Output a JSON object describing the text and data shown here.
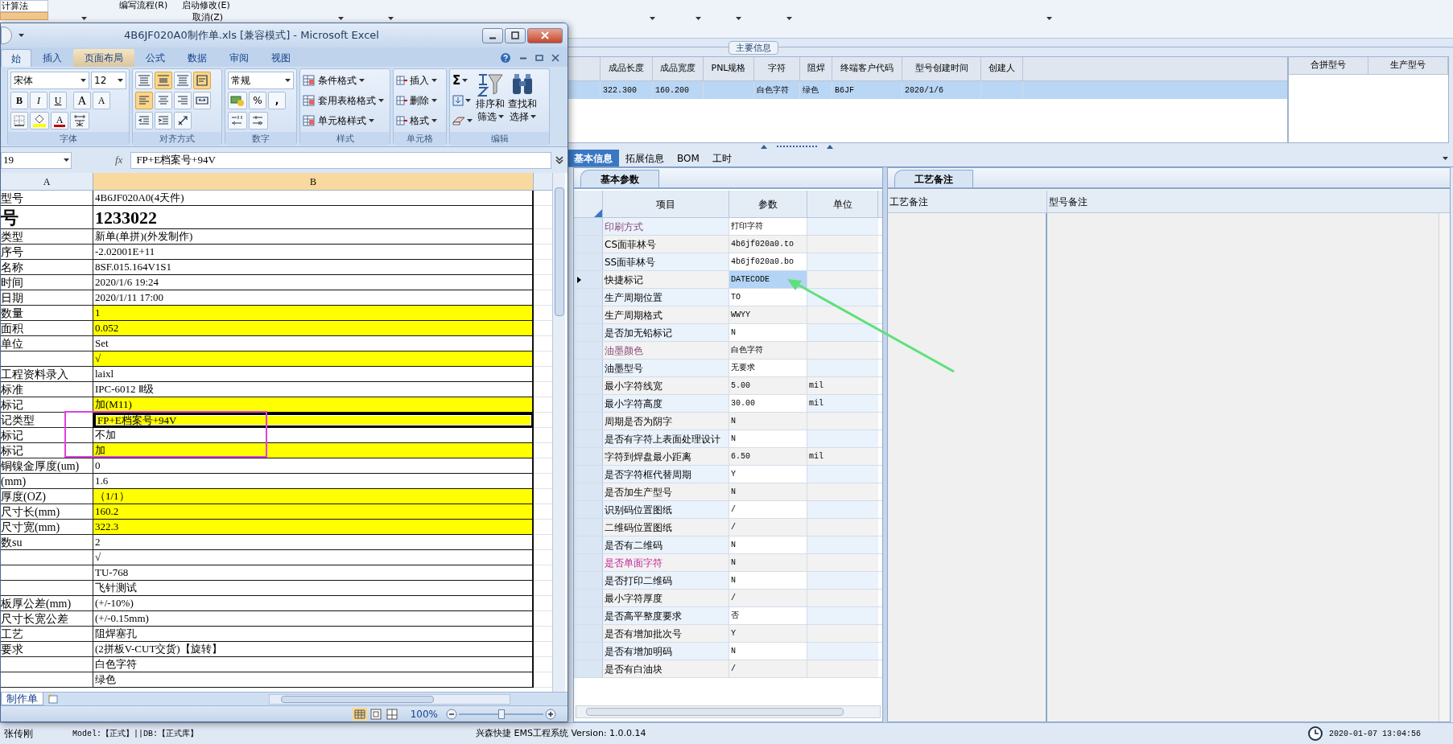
{
  "background": {
    "nav_item": "计算法",
    "toolbar": {
      "row_1": [
        "编写流程(R)",
        "启动修改(E)"
      ],
      "row_2": "取消(Z)"
    },
    "main_info": {
      "title": "主要信息",
      "columns": [
        "成品长度",
        "成品宽度",
        "PNL规格",
        "字符",
        "阻焊",
        "终端客户代码",
        "型号创建时间",
        "创建人"
      ],
      "rows": [
        {
          "selected": true,
          "cells": [
            "322.300",
            "160.200",
            null,
            "白色字符",
            "绿色",
            "B6JF",
            "2020/1/6",
            null
          ]
        }
      ]
    },
    "merge_grid": {
      "columns": [
        "合拼型号",
        "生产型号"
      ]
    },
    "tabs": [
      {
        "label": "基本信息",
        "selected": true
      },
      {
        "label": "拓展信息",
        "selected": false
      },
      {
        "label": "BOM",
        "selected": false
      },
      {
        "label": "工时",
        "selected": false
      }
    ],
    "params": {
      "tab": "基本参数",
      "columns": [
        "项目",
        "参数",
        "单位"
      ],
      "rows": [
        {
          "item": "印刷方式",
          "value": "打印字符",
          "kind": "muted",
          "selected": false
        },
        {
          "item": "CS面菲林号",
          "value": "4b6jf020a0.to",
          "kind": "plain",
          "selected": false
        },
        {
          "item": "SS面菲林号",
          "value": "4b6jf020a0.bo",
          "kind": "plain",
          "selected": false
        },
        {
          "item": "快捷标记",
          "value": "DATECODE",
          "kind": "plain",
          "selected": true
        },
        {
          "item": "生产周期位置",
          "value": "TO",
          "kind": "plain",
          "selected": false
        },
        {
          "item": "生产周期格式",
          "value": "WWYY",
          "kind": "plain",
          "selected": false
        },
        {
          "item": "是否加无铅标记",
          "value": "N",
          "kind": "plain",
          "selected": false
        },
        {
          "item": "油墨颜色",
          "value": "白色字符",
          "kind": "muted",
          "selected": false
        },
        {
          "item": "油墨型号",
          "value": "无要求",
          "kind": "plain",
          "selected": false
        },
        {
          "item": "最小字符线宽",
          "value": "5.00",
          "unit": "mil",
          "kind": "plain",
          "selected": false
        },
        {
          "item": "最小字符高度",
          "value": "30.00",
          "unit": "mil",
          "kind": "plain",
          "selected": false
        },
        {
          "item": "周期是否为阴字",
          "value": "N",
          "kind": "plain",
          "selected": false
        },
        {
          "item": "是否有字符上表面处理设计",
          "value": "N",
          "kind": "plain",
          "selected": false
        },
        {
          "item": "字符到焊盘最小距离",
          "value": "6.50",
          "unit": "mil",
          "kind": "plain",
          "selected": false
        },
        {
          "item": "是否字符框代替周期",
          "value": "Y",
          "kind": "plain",
          "selected": false
        },
        {
          "item": "是否加生产型号",
          "value": "N",
          "kind": "plain",
          "selected": false
        },
        {
          "item": "识别码位置图纸",
          "value": "/",
          "kind": "plain",
          "selected": false
        },
        {
          "item": "二维码位置图纸",
          "value": "/",
          "kind": "plain",
          "selected": false
        },
        {
          "item": "是否有二维码",
          "value": "N",
          "kind": "plain",
          "selected": false
        },
        {
          "item": "是否单面字符",
          "value": "N",
          "kind": "alert",
          "selected": false
        },
        {
          "item": "是否打印二维码",
          "value": "N",
          "kind": "plain",
          "selected": false
        },
        {
          "item": "最小字符厚度",
          "value": "/",
          "kind": "plain",
          "selected": false
        },
        {
          "item": "是否高平整度要求",
          "value": "否",
          "kind": "plain",
          "selected": false
        },
        {
          "item": "是否有增加批次号",
          "value": "Y",
          "kind": "plain",
          "selected": false
        },
        {
          "item": "是否有增加明码",
          "value": "N",
          "kind": "plain",
          "selected": false
        },
        {
          "item": "是否有白油块",
          "value": "/",
          "kind": "plain",
          "selected": false
        }
      ]
    },
    "notes": {
      "tab": "工艺备注",
      "columns": [
        "工艺备注",
        "型号备注"
      ]
    },
    "status_bar": {
      "user": "张传刚",
      "environment": "Model:【正式】||DB:【正式库】",
      "app": "兴森快捷 EMS工程系统 Version: 1.0.0.14",
      "clock": "2020-01-07 13:04:56"
    }
  },
  "excel": {
    "title": "4B6JF020A0制作单.xls  [兼容模式] - Microsoft Excel",
    "tabs": [
      {
        "label": "始",
        "selected": true,
        "hovered": false
      },
      {
        "label": "插入",
        "selected": false,
        "hovered": false
      },
      {
        "label": "页面布局",
        "selected": false,
        "hovered": true
      },
      {
        "label": "公式",
        "selected": false,
        "hovered": false
      },
      {
        "label": "数据",
        "selected": false,
        "hovered": false
      },
      {
        "label": "审阅",
        "selected": false,
        "hovered": false
      },
      {
        "label": "视图",
        "selected": false,
        "hovered": false
      }
    ],
    "font_group": {
      "label": "字体",
      "font": "宋体",
      "size": "12",
      "buttons": [
        "B",
        "I",
        "U"
      ],
      "size_buttons": [
        "A",
        "A"
      ],
      "font_color": "A"
    },
    "align_group": {
      "label": "对齐方式",
      "buttons": [
        {
          "kind": "top",
          "selected": false
        },
        {
          "kind": "middle",
          "selected": true
        },
        {
          "kind": "bottom",
          "selected": false
        },
        {
          "kind": "wrap",
          "selected": true
        },
        {
          "kind": "left",
          "selected": true
        },
        {
          "kind": "center",
          "selected": false
        },
        {
          "kind": "right",
          "selected": false
        },
        {
          "kind": "merge",
          "selected": false
        },
        {
          "kind": "outdent",
          "selected": false
        },
        {
          "kind": "indent",
          "selected": false
        },
        {
          "kind": "orient",
          "selected": false
        }
      ]
    },
    "number_group": {
      "label": "数字",
      "format": "常规",
      "buttons": [
        "%",
        ","
      ]
    },
    "styles_group": {
      "label": "样式",
      "items": [
        "条件格式",
        "套用表格格式",
        "单元格样式"
      ]
    },
    "cells_group": {
      "label": "单元格",
      "items": [
        "插入",
        "删除",
        "格式"
      ]
    },
    "editing_group": {
      "label": "编辑",
      "sum": "Σ",
      "sort": [
        "排序和",
        "筛选"
      ],
      "find": [
        "查找和",
        "选择"
      ]
    },
    "name_box": "19",
    "fx": "fx",
    "formula": "FP+E档案号+94V",
    "columns": [
      "A",
      "B"
    ],
    "rows": [
      {
        "label": "型号",
        "value": "4B6JF020A0(4天件)",
        "kind": "normal",
        "yellow": false,
        "selected": false
      },
      {
        "label": "号",
        "value": "1233022",
        "kind": "title",
        "yellow": false,
        "selected": false
      },
      {
        "label": "类型",
        "value": "新单(单拼)(外发制作)",
        "kind": "normal",
        "yellow": false,
        "selected": false
      },
      {
        "label": "序号",
        "value": "-2.02001E+11",
        "kind": "normal",
        "yellow": false,
        "selected": false
      },
      {
        "label": "名称",
        "value": "8SF.015.164V1S1",
        "kind": "normal",
        "yellow": false,
        "selected": false
      },
      {
        "label": "时间",
        "value": "2020/1/6 19:24",
        "kind": "normal",
        "yellow": false,
        "selected": false
      },
      {
        "label": "日期",
        "value": "2020/1/11 17:00",
        "kind": "normal",
        "yellow": false,
        "selected": false
      },
      {
        "label": "数量",
        "value": "1",
        "kind": "normal",
        "yellow": true,
        "selected": false
      },
      {
        "label": "面积",
        "value": "0.052",
        "kind": "normal",
        "yellow": true,
        "selected": false
      },
      {
        "label": "单位",
        "value": "Set",
        "kind": "normal",
        "yellow": false,
        "selected": false
      },
      {
        "value": "√",
        "kind": "normal",
        "yellow": true,
        "selected": false
      },
      {
        "label": "工程资料录入",
        "value": "laixl",
        "kind": "normal",
        "yellow": false,
        "selected": false
      },
      {
        "label": "标准",
        "value": "IPC-6012 Ⅱ级",
        "kind": "normal",
        "yellow": false,
        "selected": false
      },
      {
        "label": "标记",
        "value": "加(M11)",
        "kind": "normal",
        "yellow": true,
        "selected": false
      },
      {
        "label": "记类型",
        "value": "FP+E档案号+94V",
        "kind": "normal",
        "yellow": true,
        "selected": true
      },
      {
        "label": "标记",
        "value": "不加",
        "kind": "normal",
        "yellow": false,
        "selected": false
      },
      {
        "label": "标记",
        "value": "加",
        "kind": "normal",
        "yellow": true,
        "selected": false
      },
      {
        "label": "铜镍金厚度(um)",
        "value": "0",
        "kind": "normal",
        "yellow": false,
        "selected": false
      },
      {
        "label": "(mm)",
        "value": "1.6",
        "kind": "normal",
        "yellow": false,
        "selected": false
      },
      {
        "label": "厚度(OZ)",
        "value": "（1/1）",
        "kind": "normal",
        "yellow": true,
        "selected": false
      },
      {
        "label": "尺寸长(mm)",
        "value": "160.2",
        "kind": "normal",
        "yellow": true,
        "selected": false
      },
      {
        "label": "尺寸宽(mm)",
        "value": "322.3",
        "kind": "normal",
        "yellow": true,
        "selected": false
      },
      {
        "label": "数su",
        "value": "2",
        "kind": "normal",
        "yellow": false,
        "selected": false
      },
      {
        "value": "√",
        "kind": "normal",
        "yellow": false,
        "selected": false
      },
      {
        "value": "TU-768",
        "kind": "normal",
        "yellow": false,
        "selected": false
      },
      {
        "value": "飞针测试",
        "kind": "normal",
        "yellow": false,
        "selected": false
      },
      {
        "label": "板厚公差(mm)",
        "value": "(+/-10%)",
        "kind": "normal",
        "yellow": false,
        "selected": false
      },
      {
        "label": "尺寸长宽公差",
        "value": "(+/-0.15mm)",
        "kind": "normal",
        "yellow": false,
        "selected": false
      },
      {
        "label": "工艺",
        "value": "阻焊塞孔",
        "kind": "normal",
        "yellow": false,
        "selected": false
      },
      {
        "label": "要求",
        "value": "(2拼板V-CUT交货)【旋转】",
        "kind": "normal",
        "yellow": false,
        "selected": false
      },
      {
        "value": "白色字符",
        "kind": "normal",
        "yellow": false,
        "selected": false
      },
      {
        "value": "绿色",
        "kind": "normal",
        "yellow": false,
        "selected": false
      }
    ],
    "sheet_tab": "制作单",
    "zoom": {
      "reading": "100%",
      "level": 0.5
    }
  }
}
